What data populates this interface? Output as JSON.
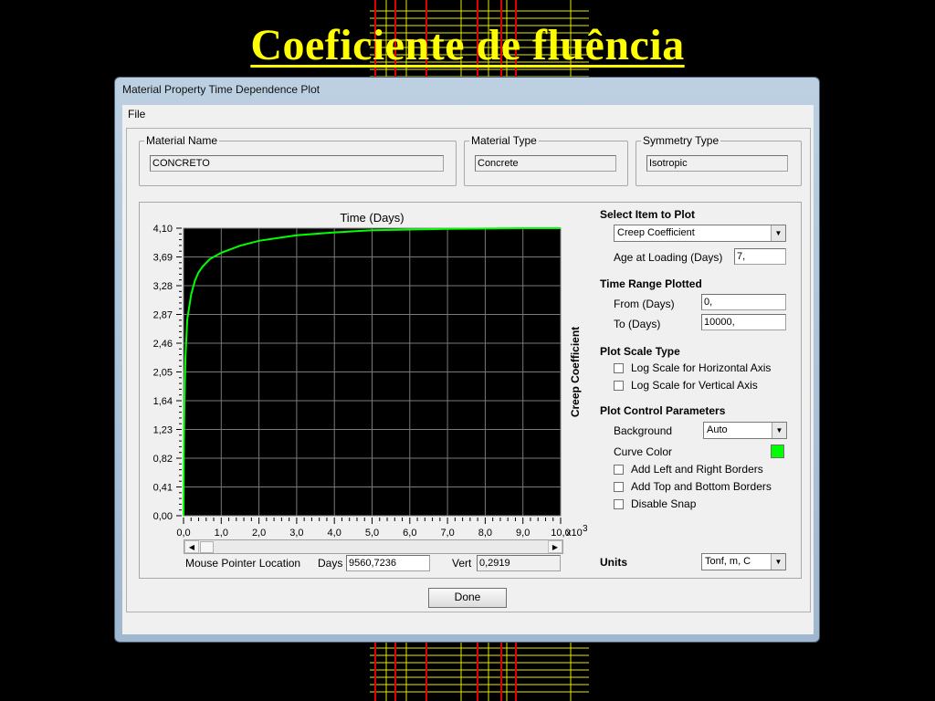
{
  "slide": {
    "title": "Coeficiente de fluência"
  },
  "window": {
    "title": "Material Property Time Dependence Plot",
    "menu_file": "File"
  },
  "material_name": {
    "label": "Material Name",
    "value": "CONCRETO"
  },
  "material_type": {
    "label": "Material Type",
    "value": "Concrete"
  },
  "symmetry_type": {
    "label": "Symmetry Type",
    "value": "Isotropic"
  },
  "controls": {
    "select_item_title": "Select Item to Plot",
    "item_value": "Creep Coefficient",
    "age_label": "Age at Loading (Days)",
    "age_value": "7,",
    "time_range_title": "Time Range Plotted",
    "from_label": "From  (Days)",
    "from_value": "0,",
    "to_label": "To  (Days)",
    "to_value": "10000,",
    "plot_scale_title": "Plot Scale Type",
    "log_h_label": "Log Scale for Horizontal Axis",
    "log_h_checked": false,
    "log_v_label": "Log Scale for Vertical Axis",
    "log_v_checked": false,
    "plot_control_title": "Plot Control Parameters",
    "background_label": "Background",
    "background_value": "Auto",
    "curve_color_label": "Curve Color",
    "curve_color": "#00ff00",
    "lr_borders_label": "Add Left and Right Borders",
    "tb_borders_label": "Add Top and Bottom Borders",
    "snap_label": "Disable Snap",
    "units_label": "Units",
    "units_value": "Tonf, m, C"
  },
  "mouse": {
    "label": "Mouse Pointer Location",
    "days_label": "Days",
    "days_value": "9560,7236",
    "vert_label": "Vert",
    "vert_value": "0,2919"
  },
  "buttons": {
    "done": "Done"
  },
  "chart_data": {
    "type": "line",
    "title": "Time  (Days)",
    "ylabel": "Creep Coefficient",
    "xlabel": "",
    "x_multiplier_label": "x10",
    "x_multiplier_exp": "3",
    "xlim": [
      0,
      10000
    ],
    "ylim": [
      0,
      4.1
    ],
    "x_ticks": [
      "0,0",
      "1,0",
      "2,0",
      "3,0",
      "4,0",
      "5,0",
      "6,0",
      "7,0",
      "8,0",
      "9,0",
      "10,0"
    ],
    "y_ticks": [
      "0,00",
      "0,41",
      "0,82",
      "1,23",
      "1,64",
      "2,05",
      "2,46",
      "2,87",
      "3,28",
      "3,69",
      "4,10"
    ],
    "grid": true,
    "background": "#000000",
    "series": [
      {
        "color": "#00ff00",
        "x": [
          0,
          10,
          25,
          50,
          100,
          200,
          300,
          400,
          500,
          700,
          1000,
          1500,
          2000,
          2500,
          3000,
          4000,
          5000,
          6000,
          7000,
          8000,
          9000,
          10000
        ],
        "y": [
          0,
          1.0,
          1.6,
          2.25,
          2.8,
          3.15,
          3.35,
          3.47,
          3.55,
          3.66,
          3.75,
          3.85,
          3.92,
          3.96,
          4.0,
          4.04,
          4.07,
          4.08,
          4.09,
          4.095,
          4.1,
          4.1
        ]
      }
    ]
  }
}
